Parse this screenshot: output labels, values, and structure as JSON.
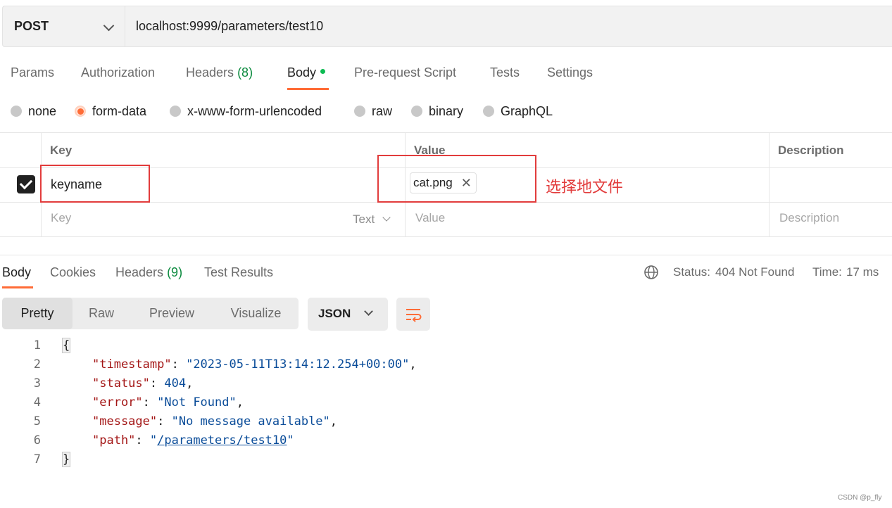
{
  "request": {
    "method": "POST",
    "url": "localhost:9999/parameters/test10",
    "tabs": {
      "params": "Params",
      "authorization": "Authorization",
      "headers": "Headers",
      "headers_count": "(8)",
      "body": "Body",
      "prerequest": "Pre-request Script",
      "tests": "Tests",
      "settings": "Settings"
    },
    "body_modes": {
      "none": "none",
      "form_data": "form-data",
      "urlencoded": "x-www-form-urlencoded",
      "raw": "raw",
      "binary": "binary",
      "graphql": "GraphQL"
    },
    "selected_body_mode": "form-data",
    "table": {
      "col_key": "Key",
      "col_value": "Value",
      "col_description": "Description",
      "row": {
        "checked": true,
        "key": "keyname",
        "file": "cat.png"
      },
      "new_row": {
        "key_placeholder": "Key",
        "type": "Text",
        "value_placeholder": "Value",
        "description_placeholder": "Description"
      }
    },
    "annotation": "选择地文件"
  },
  "response": {
    "tabs": {
      "body": "Body",
      "cookies": "Cookies",
      "headers": "Headers",
      "headers_count": "(9)",
      "test_results": "Test Results"
    },
    "status_label": "Status:",
    "status_value": "404 Not Found",
    "time_label": "Time:",
    "time_value": "17 ms",
    "view_modes": {
      "pretty": "Pretty",
      "raw": "Raw",
      "preview": "Preview",
      "visualize": "Visualize"
    },
    "format": "JSON",
    "code": {
      "line_numbers": [
        "1",
        "2",
        "3",
        "4",
        "5",
        "6",
        "7"
      ],
      "open": "{",
      "close": "}",
      "timestamp_key": "\"timestamp\"",
      "timestamp_val": "\"2023-05-11T13:14:12.254+00:00\"",
      "status_key": "\"status\"",
      "status_val": "404",
      "error_key": "\"error\"",
      "error_val": "\"Not Found\"",
      "message_key": "\"message\"",
      "message_val": "\"No message available\"",
      "path_key": "\"path\"",
      "path_q1": "\"",
      "path_val": "/parameters/test10",
      "path_q2": "\""
    }
  },
  "watermark": "CSDN @p_fly",
  "colors": {
    "accent": "#ff6c37",
    "success": "#0b8a3e",
    "annotation_red": "#e23c3c"
  }
}
